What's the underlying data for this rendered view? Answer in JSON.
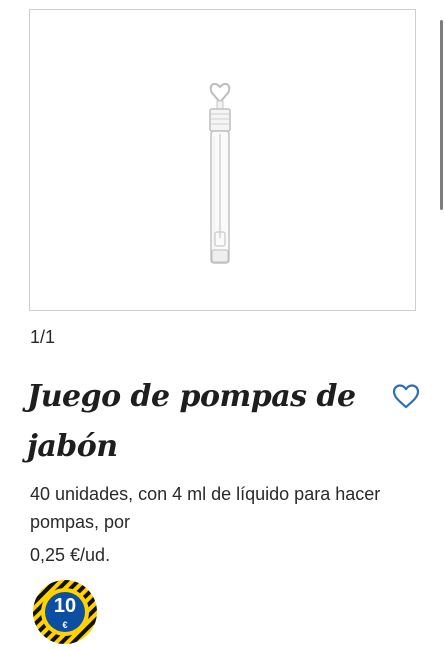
{
  "gallery": {
    "counter": "1/1",
    "image_icon": "bubble-wand-tube-image"
  },
  "product": {
    "title": "Juego de pompas de jabón",
    "description": "40 unidades, con 4 ml de líquido para hacer pompas, por",
    "unit_price": "0,25 €/ud."
  },
  "favorite": {
    "icon": "heart-outline-icon",
    "color": "#2f6fb3"
  },
  "badge": {
    "value": "10",
    "currency": "€",
    "ring_color": "#ffd200",
    "center_color": "#0b4ea2",
    "stripe_color": "#111111"
  },
  "colors": {
    "text": "#1f1f1f",
    "image_border": "#cfcfcf"
  }
}
